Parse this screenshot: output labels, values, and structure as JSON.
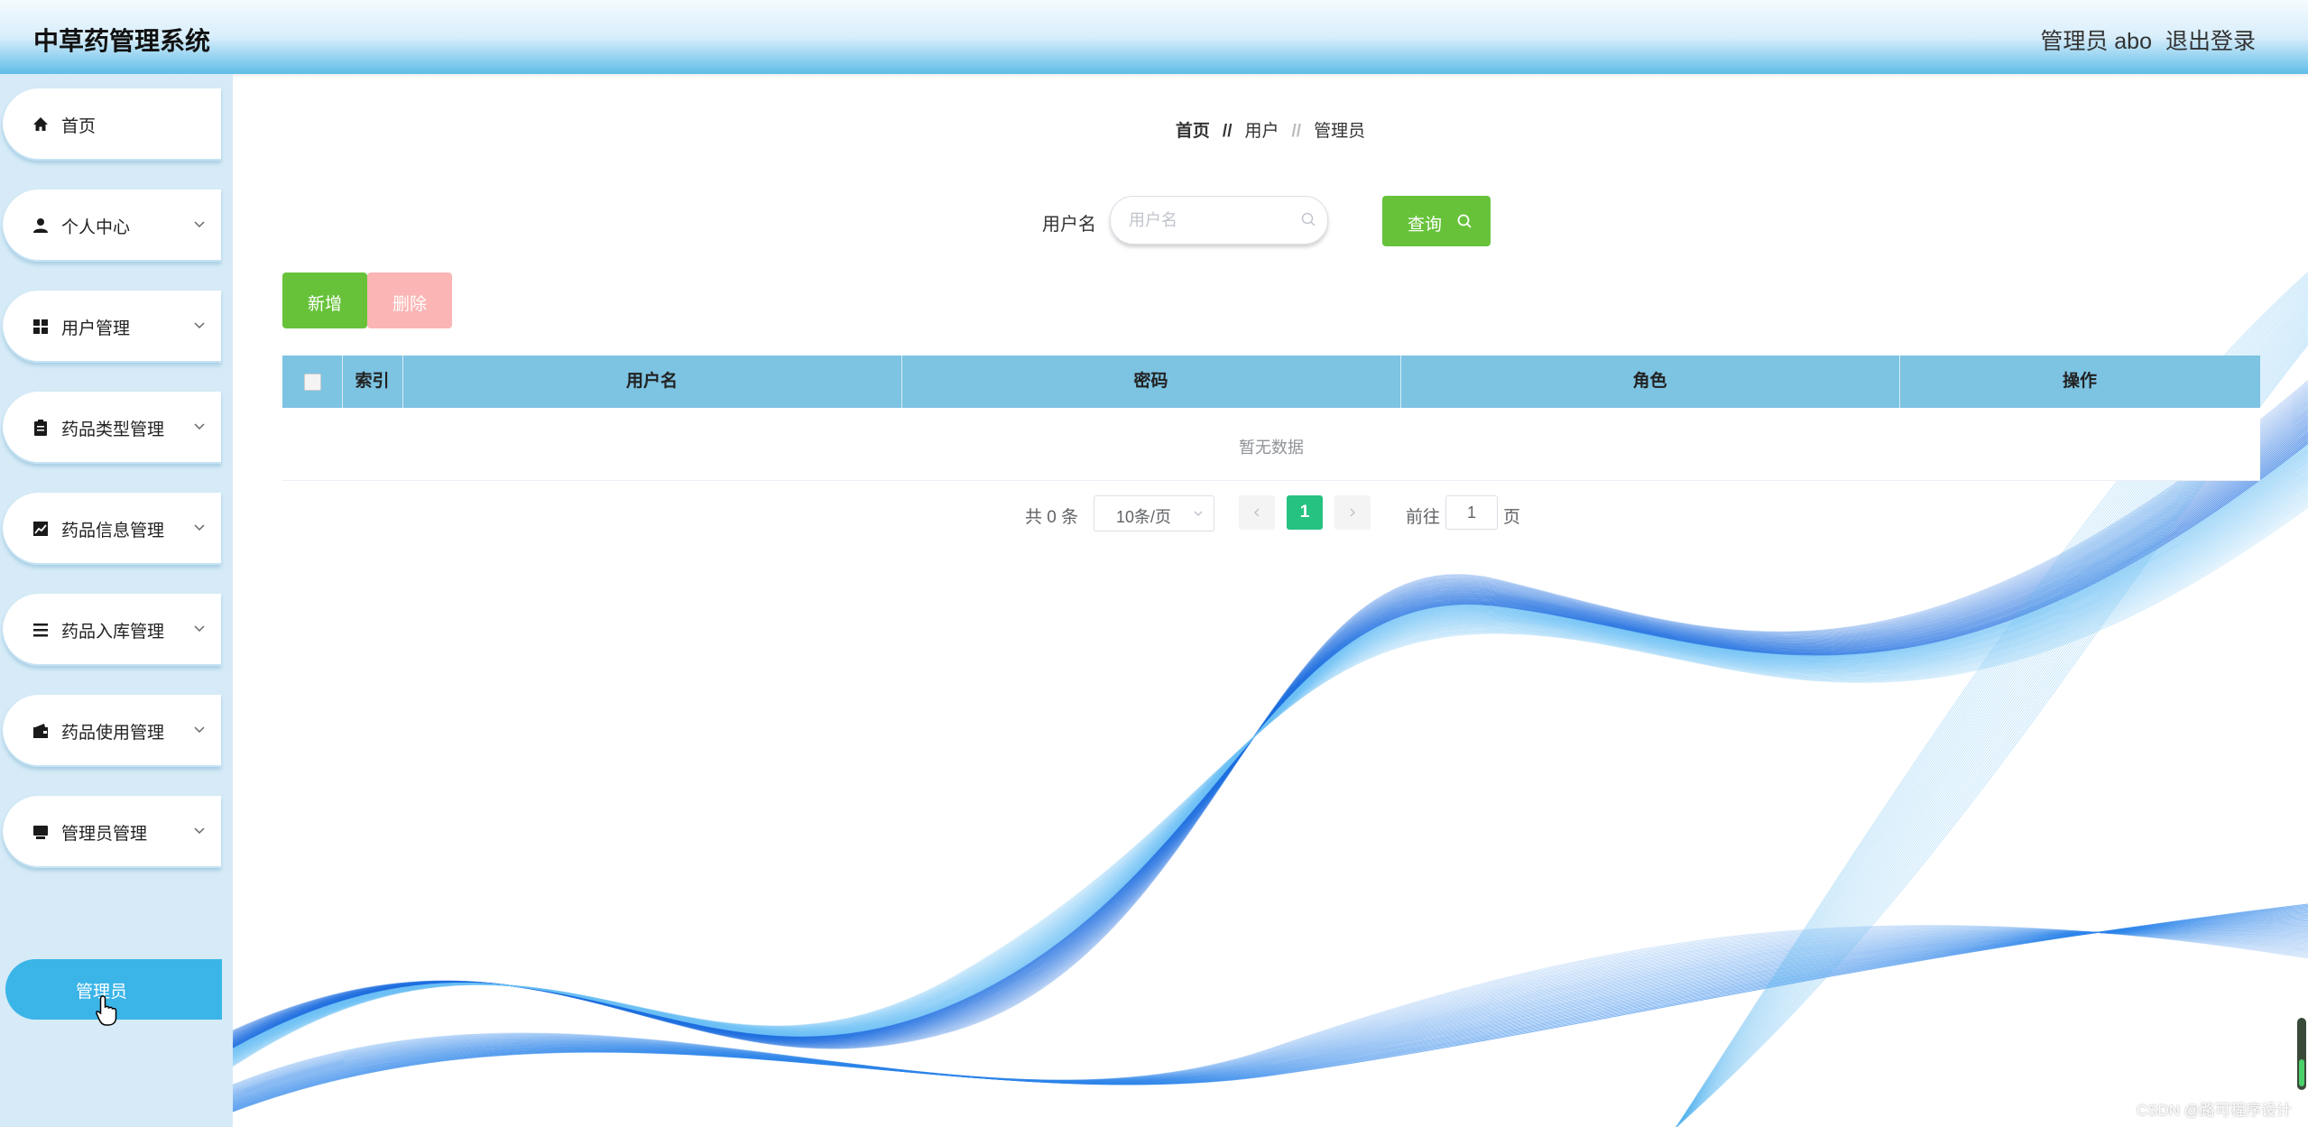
{
  "header": {
    "app_title": "中草药管理系统",
    "user_label": "管理员 abo",
    "logout_label": "退出登录"
  },
  "sidebar": {
    "items": [
      {
        "label": "首页",
        "icon": "home-icon",
        "has_submenu": false
      },
      {
        "label": "个人中心",
        "icon": "person-icon",
        "has_submenu": true
      },
      {
        "label": "用户管理",
        "icon": "grid-icon",
        "has_submenu": true
      },
      {
        "label": "药品类型管理",
        "icon": "clipboard-icon",
        "has_submenu": true
      },
      {
        "label": "药品信息管理",
        "icon": "chart-icon",
        "has_submenu": true
      },
      {
        "label": "药品入库管理",
        "icon": "list-icon",
        "has_submenu": true
      },
      {
        "label": "药品使用管理",
        "icon": "wallet-icon",
        "has_submenu": true
      },
      {
        "label": "管理员管理",
        "icon": "monitor-icon",
        "has_submenu": true
      }
    ],
    "active_subitem": {
      "label": "管理员"
    }
  },
  "breadcrumb": {
    "home": "首页",
    "separator": "//",
    "mid": "用户",
    "current": "管理员"
  },
  "search": {
    "label": "用户名",
    "placeholder": "用户名",
    "value": "",
    "query_label": "查询"
  },
  "actions": {
    "add_label": "新增",
    "delete_label": "删除"
  },
  "table": {
    "columns": [
      "索引",
      "用户名",
      "密码",
      "角色",
      "操作"
    ],
    "rows": [],
    "empty_text": "暂无数据",
    "header_color": "#7dc3e2"
  },
  "pagination": {
    "total_text": "共 0 条",
    "page_size": "10条/页",
    "current_page": "1",
    "goto_label": "前往",
    "goto_value": "1",
    "goto_suffix": "页",
    "active_color": "#26c281"
  },
  "colors": {
    "primary_green": "#67c23a",
    "danger_disabled": "#fbb5b5",
    "sidebar_bg": "#d6ebf7",
    "active_menu": "#3bb5e8"
  },
  "watermark": "CSDN @路可程序设计"
}
